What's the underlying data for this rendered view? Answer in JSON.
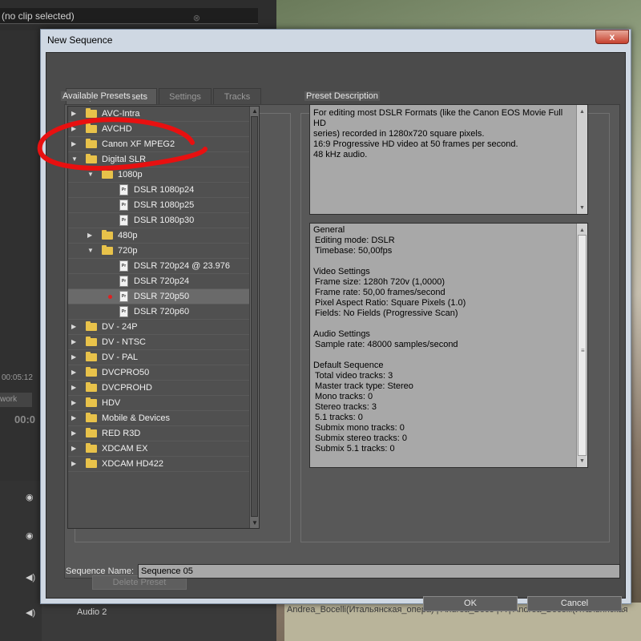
{
  "background": {
    "clip_field": "(no clip selected)",
    "timecode_1": "00:05:12",
    "tab_fragment": "work",
    "timecode_2": "00:0",
    "audio_track_label": "Audio 2",
    "bottom_clip_text": "Andrea_Bocelli(Итальянская_опера) | Andrea_Boce | A | Andrea_Bocelli(Итальянская"
  },
  "dialog": {
    "title": "New Sequence",
    "close_label": "x",
    "tabs": [
      {
        "label": "Sequence Presets"
      },
      {
        "label": "Settings"
      },
      {
        "label": "Tracks"
      }
    ],
    "available_presets_label": "Available Presets",
    "preset_description_label": "Preset Description",
    "tree": [
      {
        "label": "AVC-Intra",
        "type": "folder",
        "level": 0,
        "expanded": false
      },
      {
        "label": "AVCHD",
        "type": "folder",
        "level": 0,
        "expanded": false
      },
      {
        "label": "Canon XF MPEG2",
        "type": "folder",
        "level": 0,
        "expanded": false
      },
      {
        "label": "Digital SLR",
        "type": "folder",
        "level": 0,
        "expanded": true
      },
      {
        "label": "1080p",
        "type": "folder",
        "level": 1,
        "expanded": true
      },
      {
        "label": "DSLR 1080p24",
        "type": "file",
        "level": 2
      },
      {
        "label": "DSLR 1080p25",
        "type": "file",
        "level": 2
      },
      {
        "label": "DSLR 1080p30",
        "type": "file",
        "level": 2
      },
      {
        "label": "480p",
        "type": "folder",
        "level": 1,
        "expanded": false
      },
      {
        "label": "720p",
        "type": "folder",
        "level": 1,
        "expanded": true
      },
      {
        "label": "DSLR 720p24 @ 23.976",
        "type": "file",
        "level": 2
      },
      {
        "label": "DSLR 720p24",
        "type": "file",
        "level": 2
      },
      {
        "label": "DSLR 720p50",
        "type": "file",
        "level": 2,
        "selected": true
      },
      {
        "label": "DSLR 720p60",
        "type": "file",
        "level": 2
      },
      {
        "label": "DV - 24P",
        "type": "folder",
        "level": 0,
        "expanded": false
      },
      {
        "label": "DV - NTSC",
        "type": "folder",
        "level": 0,
        "expanded": false
      },
      {
        "label": "DV - PAL",
        "type": "folder",
        "level": 0,
        "expanded": false
      },
      {
        "label": "DVCPRO50",
        "type": "folder",
        "level": 0,
        "expanded": false
      },
      {
        "label": "DVCPROHD",
        "type": "folder",
        "level": 0,
        "expanded": false
      },
      {
        "label": "HDV",
        "type": "folder",
        "level": 0,
        "expanded": false
      },
      {
        "label": "Mobile & Devices",
        "type": "folder",
        "level": 0,
        "expanded": false
      },
      {
        "label": "RED R3D",
        "type": "folder",
        "level": 0,
        "expanded": false
      },
      {
        "label": "XDCAM EX",
        "type": "folder",
        "level": 0,
        "expanded": false
      },
      {
        "label": "XDCAM HD422",
        "type": "folder",
        "level": 0,
        "expanded": false
      }
    ],
    "file_icon_text": "Pr",
    "description_lines": [
      "For editing most DSLR Formats (like the Canon EOS Movie Full HD",
      "series) recorded in 1280x720 square pixels.",
      "16:9 Progressive HD video at 50 frames per second.",
      "48 kHz audio."
    ],
    "info_lines": [
      {
        "text": "General",
        "indent": false
      },
      {
        "text": "Editing mode: DSLR",
        "indent": true
      },
      {
        "text": "Timebase: 50,00fps",
        "indent": true
      },
      {
        "text": "",
        "indent": false
      },
      {
        "text": "Video Settings",
        "indent": false
      },
      {
        "text": "Frame size: 1280h 720v (1,0000)",
        "indent": true
      },
      {
        "text": "Frame rate: 50,00 frames/second",
        "indent": true
      },
      {
        "text": "Pixel Aspect Ratio: Square Pixels (1.0)",
        "indent": true
      },
      {
        "text": "Fields: No Fields (Progressive Scan)",
        "indent": true
      },
      {
        "text": "",
        "indent": false
      },
      {
        "text": "Audio Settings",
        "indent": false
      },
      {
        "text": "Sample rate: 48000 samples/second",
        "indent": true
      },
      {
        "text": "",
        "indent": false
      },
      {
        "text": "Default Sequence",
        "indent": false
      },
      {
        "text": "Total video tracks: 3",
        "indent": true
      },
      {
        "text": "Master track type: Stereo",
        "indent": true
      },
      {
        "text": "Mono tracks: 0",
        "indent": true
      },
      {
        "text": "Stereo tracks: 3",
        "indent": true
      },
      {
        "text": "5.1 tracks: 0",
        "indent": true
      },
      {
        "text": "Submix mono tracks: 0",
        "indent": true
      },
      {
        "text": "Submix stereo tracks: 0",
        "indent": true
      },
      {
        "text": "Submix 5.1 tracks: 0",
        "indent": true
      }
    ],
    "delete_preset_label": "Delete Preset",
    "sequence_name_label": "Sequence Name:",
    "sequence_name_value": "Sequence 05",
    "ok_label": "OK",
    "cancel_label": "Cancel"
  },
  "colors": {
    "annotation": "#e81010",
    "folder": "#e8c24a",
    "selection_dot": "#e02020"
  }
}
